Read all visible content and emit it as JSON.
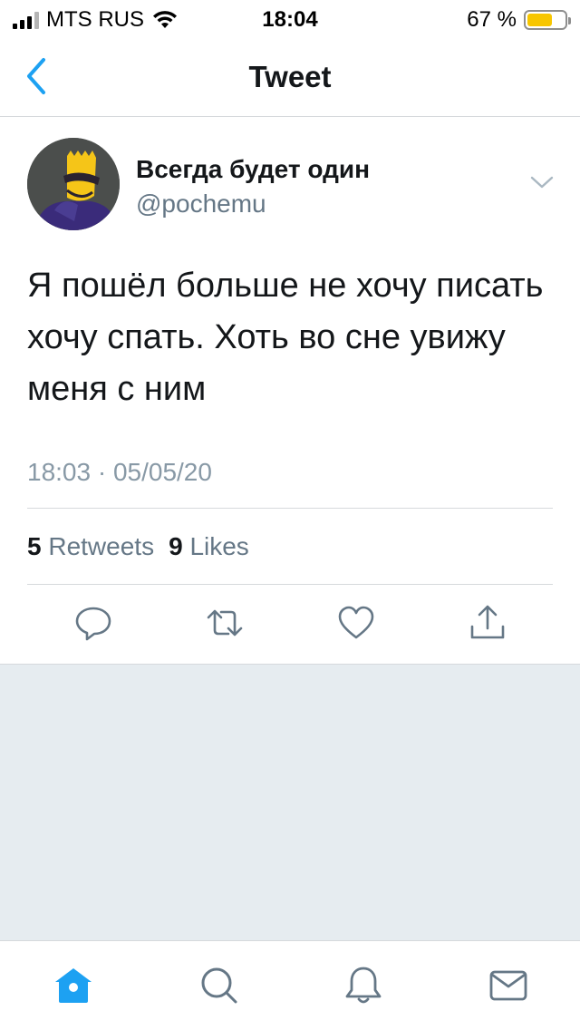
{
  "status_bar": {
    "carrier": "MTS RUS",
    "time": "18:04",
    "battery_percent": "67 %",
    "battery_level": 0.67,
    "signal_bars_on": 3,
    "signal_bars_total": 4
  },
  "nav": {
    "title": "Tweet",
    "back_icon": "chevron-left-icon"
  },
  "tweet": {
    "author_name": "Всегда будет один",
    "author_handle": "@pochemu",
    "text": "Я пошёл больше не хочу писать хочу спать. Хоть во сне увижу меня с ним",
    "timestamp": "18:03 · 05/05/20",
    "retweets_count": "5",
    "retweets_label": "Retweets",
    "likes_count": "9",
    "likes_label": "Likes"
  },
  "actions": [
    "reply-icon",
    "retweet-icon",
    "like-icon",
    "share-icon"
  ],
  "tabs": [
    "home-icon",
    "search-icon",
    "notifications-icon",
    "messages-icon"
  ],
  "colors": {
    "accent": "#1da1f2",
    "text": "#14171a",
    "secondary": "#657786",
    "icon_gray": "#657786",
    "background_gray": "#e6ecf0"
  }
}
